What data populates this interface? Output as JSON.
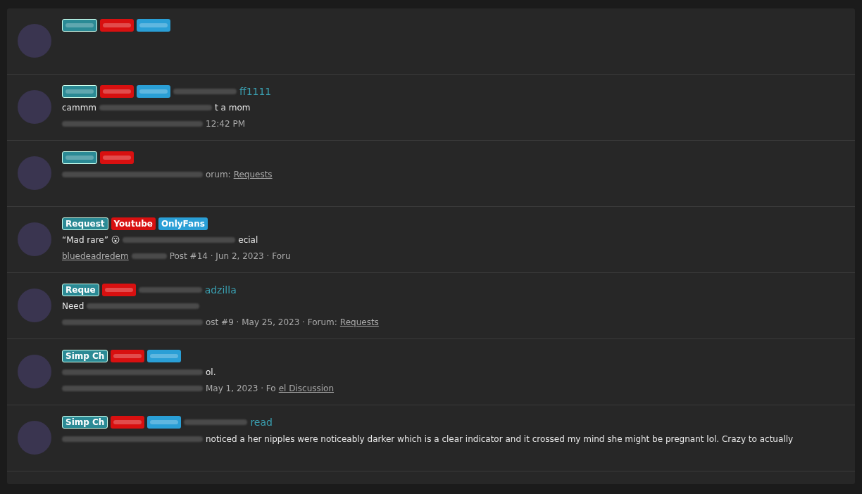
{
  "results": [
    {
      "tags": [
        {
          "kind": "request"
        },
        {
          "kind": "youtube"
        },
        {
          "kind": "onlyfans"
        }
      ]
    },
    {
      "tags": [
        {
          "kind": "request"
        },
        {
          "kind": "youtube"
        },
        {
          "kind": "onlyfans"
        }
      ],
      "title": "ff1111",
      "snippet": "cammm",
      "snippet_end": "t a mom",
      "meta": "12:42 PM"
    },
    {
      "tags": [
        {
          "kind": "request"
        },
        {
          "kind": "youtube"
        }
      ],
      "meta": "orum:",
      "forum": "Requests"
    },
    {
      "tags": [
        {
          "kind": "request",
          "label": "Request"
        },
        {
          "kind": "youtube",
          "label": "Youtube"
        },
        {
          "kind": "onlyfans",
          "label": "OnlyFans"
        }
      ],
      "snippet": "“Mad rare” 😮",
      "snippet_end": "ecial",
      "user": "bluedeadredem",
      "meta": "Post #14 · Jun 2, 2023 · Foru"
    },
    {
      "tags": [
        {
          "kind": "request",
          "label": "Reque"
        },
        {
          "kind": "youtube"
        }
      ],
      "title": "adzilla",
      "snippet": "Need",
      "meta": "ost #9 · May 25, 2023 · Forum:",
      "forum": "Requests"
    },
    {
      "tags": [
        {
          "kind": "request",
          "label": "Simp Ch"
        },
        {
          "kind": "youtube"
        },
        {
          "kind": "onlyfans"
        }
      ],
      "snippet_end": "ol.",
      "meta": "May 1, 2023 · Fo",
      "forum": "el Discussion"
    },
    {
      "tags": [
        {
          "kind": "request",
          "label": "Simp Ch"
        },
        {
          "kind": "youtube"
        },
        {
          "kind": "onlyfans"
        }
      ],
      "title": "read",
      "snippet_end": "noticed a  her nipples were noticeably darker which is a clear indicator and it crossed my mind she might be pregnant lol. Crazy to actually"
    }
  ]
}
